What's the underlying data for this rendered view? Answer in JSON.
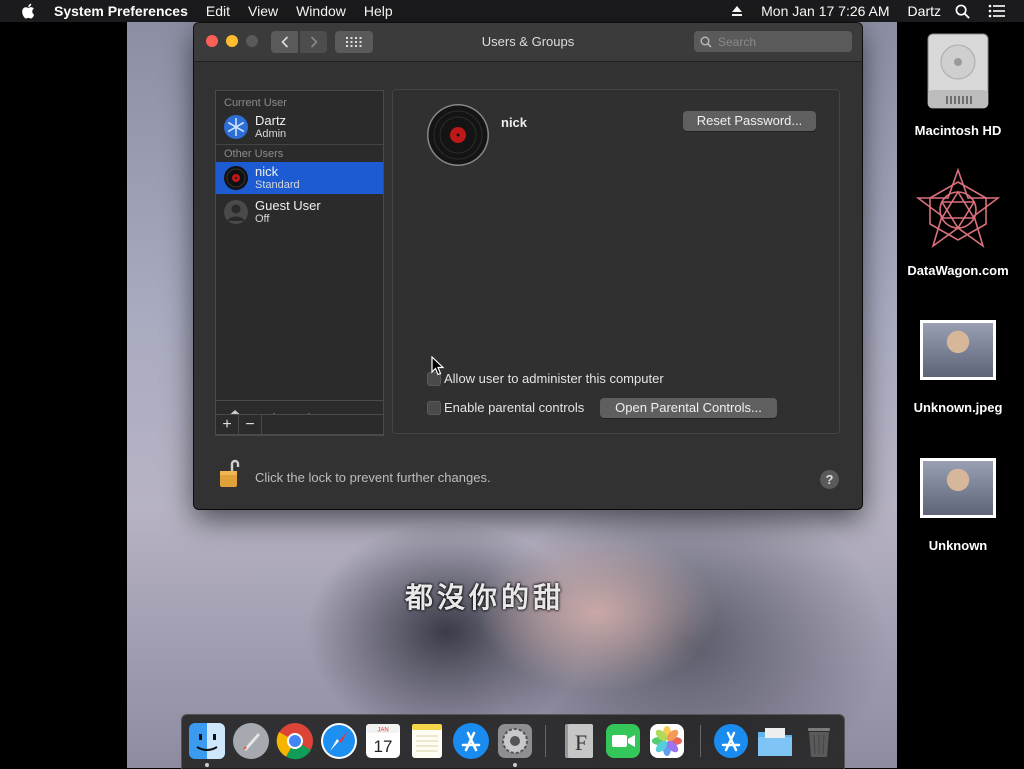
{
  "menubar": {
    "app_name": "System Preferences",
    "menus": [
      "Edit",
      "View",
      "Window",
      "Help"
    ],
    "clock": "Mon Jan 17  7:26 AM",
    "user": "Dartz"
  },
  "window": {
    "title": "Users & Groups",
    "search_placeholder": "Search"
  },
  "users": {
    "current_label": "Current User",
    "current": {
      "name": "Dartz",
      "role": "Admin"
    },
    "other_label": "Other Users",
    "others": [
      {
        "name": "nick",
        "role": "Standard"
      },
      {
        "name": "Guest User",
        "role": "Off"
      }
    ],
    "login_options": "Login Options",
    "add_symbol": "+",
    "remove_symbol": "−"
  },
  "detail": {
    "username": "nick",
    "reset_password": "Reset Password...",
    "allow_admin_label": "Allow user to administer this computer",
    "allow_admin_checked": false,
    "parental_label": "Enable parental controls",
    "parental_checked": false,
    "open_parental": "Open Parental Controls..."
  },
  "lock": {
    "message": "Click the lock to prevent further changes.",
    "help": "?"
  },
  "desktop": {
    "icons": [
      {
        "label": "Macintosh HD",
        "icon": "hard-drive-icon"
      },
      {
        "label": "DataWagon.com",
        "icon": "star-logo-icon"
      },
      {
        "label": "Unknown.jpeg",
        "icon": "image-file-icon"
      },
      {
        "label": "Unknown",
        "icon": "image-file-icon"
      }
    ],
    "wallpaper_caption": "都沒你的甜"
  },
  "dock": {
    "apps": [
      "finder-icon",
      "launchpad-icon",
      "chrome-icon",
      "safari-icon",
      "calendar-icon",
      "notes-icon",
      "app-store-icon",
      "system-preferences-icon",
      "font-book-icon",
      "facetime-icon",
      "photos-icon",
      "app-store-folder-icon",
      "downloads-folder-icon",
      "trash-icon"
    ],
    "calendar_month": "JAN",
    "calendar_day": "17"
  },
  "colors": {
    "selection": "#1c5bd1",
    "close": "#fe5f57",
    "minimize": "#febc2e"
  }
}
